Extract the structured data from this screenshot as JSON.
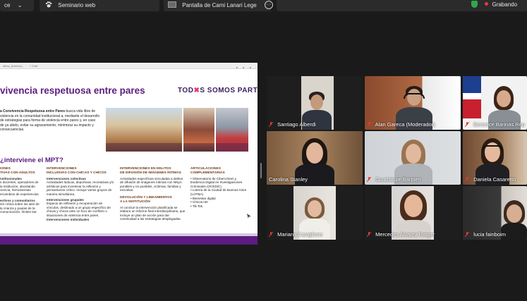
{
  "topbar": {
    "left_tab": "ce",
    "seminar_tab": "Seminario web",
    "share_tab": "Pantalla de Cami Lanari Lege",
    "recording_label": "Grabando"
  },
  "slide": {
    "browser_url": "alima_(Interna)...",
    "browser_tab": "+ Chat",
    "title": "vivencia respetuosa entre pares",
    "logo_prefix": "TOD",
    "logo_mark": "✖",
    "logo_suffix": "S SOMOS PARTE",
    "intro_bold": "a Convivencia Respetuosa entre Pares",
    "intro_rest": " busca vida libre de violencia en la comunidad institucional a, mediante el desarrollo de estrategias para forma de violencia entre pares y, en caso de ya ubido, evitar su agravamiento, minimizar su impacto y consecuencias.",
    "question": "interviene el MPT?",
    "columns": [
      {
        "heading": "IONES\nTIVAS CON ADULTOS",
        "sub1": "nstitucionales",
        "text1": "s docentes, operadores de la institución, abordando ciencia, herramientas ercambios de experiencias",
        "sub2": "ectivos y comunitarios",
        "text2": "ión crítica sobre los ales de la crianza y pautas de la comunicación, límites tiar."
      },
      {
        "heading": "INTERVENCIONES\nINCLUSIVAS CON CHICAS Y CHICOS",
        "sub1": "Intervenciones colectivas",
        "text1": "Actividades lúdicas, deportivas, recreativas y/o artísticas para incentivar la reflexión y pensamiento crítico. Incluye varios grupos de manera simultánea.",
        "sub2": "Intervenciones grupales",
        "text2": "Espacio de reflexión y recuperación de vínculos, destinado a un grupo específico de chicas y chicos ante un foco de conflicto o situaciones de violencia entre pares.",
        "sub3": "Intervenciones individuales"
      },
      {
        "heading": "INTERVENCIONES EN DELITOS\nDE DIFUSIÓN DE IMÁGENES ÍNTIMAS",
        "text1": "Actividades específicas vinculadas a delitos de difusión de imágenes íntimas con NNyA punibles y no punibles, víctimas, familias y escuelas.",
        "heading2": "DEVOLUCIÓN Y LINEAMIENTOS\nA LA INSTITUCIÓN",
        "text2": "Al concluir la intervención planificada se elabora un informe final interdisciplinario, que incluye un plan de acción para dar continuidad a las estrategias desplegadas."
      },
      {
        "heading": "ARTICULACIONES\nCOMPLEMENTARIAS",
        "items": [
          "Observatorio de Cibercrimen y Evidencia Digital en Investigaciones Criminales (OCEDIC)",
          "Lotería de la Ciudad de Buenos Aires (LOTBA)",
          "Bienestar digital",
          "Chicos.net",
          "Tik Tok"
        ]
      }
    ]
  },
  "participants": [
    {
      "name": "Santiago Alberdi",
      "active": false
    },
    {
      "name": "Alan Gareca (Moderador)",
      "active": false
    },
    {
      "name": "Berenice Barinas Rep",
      "active": false
    },
    {
      "name": "Carolina Stanley",
      "active": true
    },
    {
      "name": "Guadalupe Barbieri",
      "active": false
    },
    {
      "name": "Daniela Casaretto",
      "active": false
    },
    {
      "name": "Mariana Caviglione",
      "active": false
    },
    {
      "name": "Mercedes Alvarez Rotger",
      "active": false
    },
    {
      "name": "lucia fainboim",
      "active": false
    }
  ],
  "colors": {
    "slide_purple": "#5c1c80",
    "active_speaker": "#2fbf5a",
    "recording_red": "#e53935",
    "mic_muted": "#e53935"
  }
}
